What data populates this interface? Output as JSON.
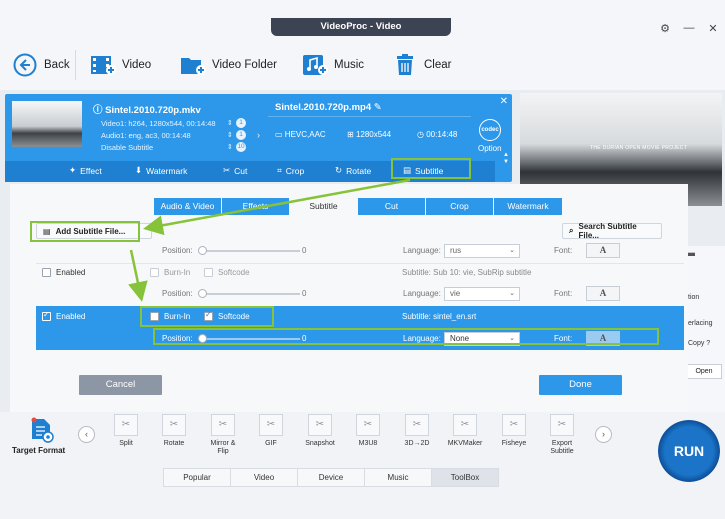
{
  "window": {
    "title": "VideoProc - Video"
  },
  "toolbar": {
    "back": "Back",
    "video": "Video",
    "video_folder": "Video Folder",
    "music": "Music",
    "clear": "Clear"
  },
  "item": {
    "source_name": "Sintel.2010.720p.mkv",
    "video_info": "Video1: h264, 1280x544, 00:14:48",
    "audio_info": "Audio1: eng, ac3, 00:14:48",
    "subtitle_info": "Disable Subtitle",
    "video_count": "1",
    "audio_count": "1",
    "subtitle_count": "10",
    "output_name": "Sintel.2010.720p.mp4",
    "output_codec": "HEVC,AAC",
    "output_resolution": "1280x544",
    "output_duration": "00:14:48",
    "codec_badge": "codec",
    "option_label": "Option"
  },
  "edit_tools": [
    "Effect",
    "Watermark",
    "Cut",
    "Crop",
    "Rotate",
    "Subtitle"
  ],
  "preview": {
    "caption": "THE DURIAN OPEN MOVIE PROJECT"
  },
  "right_panel": {
    "option": "tion",
    "interlacing": "erlacing",
    "copy": "Copy",
    "open": "Open"
  },
  "dialog": {
    "tabs": [
      "Audio & Video",
      "Effects",
      "Subtitle",
      "Cut",
      "Crop",
      "Watermark"
    ],
    "add_subtitle": "Add Subtitle File...",
    "search_subtitle": "Search Subtitle File...",
    "rows": {
      "r1_position": "Position:",
      "r1_value": "0",
      "r1_language_label": "Language:",
      "r1_language": "rus",
      "r1_font": "Font:",
      "r2_enabled": "Enabled",
      "r2_burnin": "Burn-In",
      "r2_softcode": "Softcode",
      "r2_subtitle": "Subtitle: Sub 10: vie, SubRip subtitle",
      "r3_position": "Position:",
      "r3_value": "0",
      "r3_language_label": "Language:",
      "r3_language": "vie",
      "r3_font": "Font:",
      "r4_enabled": "Enabled",
      "r4_burnin": "Burn-In",
      "r4_softcode": "Softcode",
      "r4_subtitle": "Subtitle: sintel_en.srt",
      "r5_position": "Position:",
      "r5_value": "0",
      "r5_language_label": "Language:",
      "r5_language": "None",
      "r5_font": "Font:",
      "font_glyph": "A"
    },
    "cancel": "Cancel",
    "done": "Done"
  },
  "bottom": {
    "target_format": "Target Format",
    "tools": [
      "Split",
      "Rotate",
      "Mirror & Flip",
      "GIF",
      "Snapshot",
      "M3U8",
      "3D→2D",
      "MKVMaker",
      "Fisheye",
      "Export Subtitle"
    ],
    "tabs": [
      "Popular",
      "Video",
      "Device",
      "Music",
      "ToolBox"
    ],
    "run": "RUN"
  },
  "colors": {
    "accent": "#2d98ea",
    "highlight": "#86c33a"
  }
}
